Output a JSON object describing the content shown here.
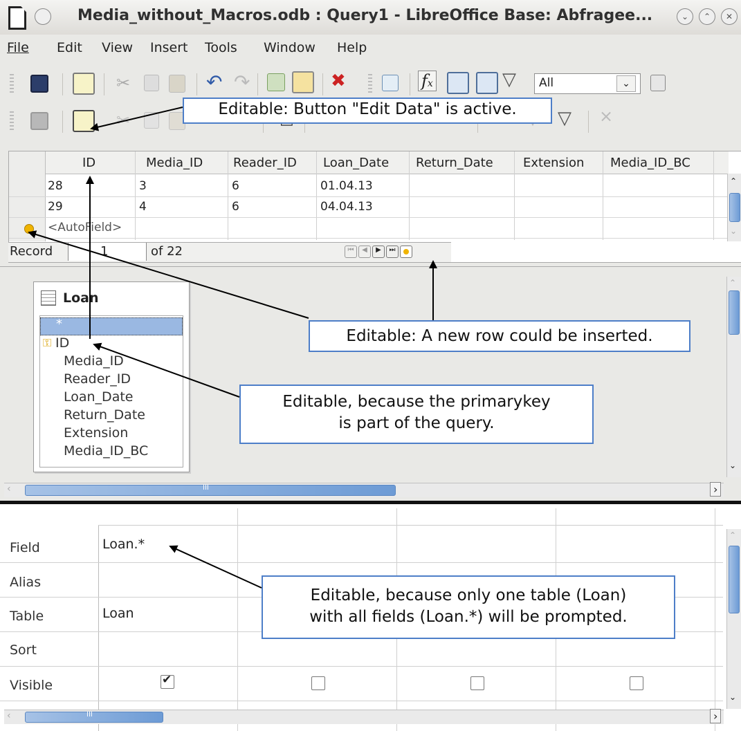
{
  "window": {
    "title": "Media_without_Macros.odb : Query1 - LibreOffice Base: Abfragee..."
  },
  "menu": [
    {
      "label": "File"
    },
    {
      "label": "Edit"
    },
    {
      "label": "View"
    },
    {
      "label": "Insert"
    },
    {
      "label": "Tools"
    },
    {
      "label": "Window"
    },
    {
      "label": "Help"
    }
  ],
  "toolbar": {
    "limit_value": "All"
  },
  "grid": {
    "columns": [
      "ID",
      "Media_ID",
      "Reader_ID",
      "Loan_Date",
      "Return_Date",
      "Extension",
      "Media_ID_BC"
    ],
    "rows": [
      [
        "28",
        "3",
        "6",
        "01.04.13",
        "",
        "",
        ""
      ],
      [
        "29",
        "4",
        "6",
        "04.04.13",
        "",
        "",
        ""
      ]
    ],
    "new_row_placeholder": "<AutoField>",
    "record_label": "Record",
    "record_number": "1",
    "record_of": "of 22"
  },
  "table_window": {
    "name": "Loan",
    "all_fields": "*",
    "fields": [
      "ID",
      "Media_ID",
      "Reader_ID",
      "Loan_Date",
      "Return_Date",
      "Extension",
      "Media_ID_BC"
    ]
  },
  "criteria": {
    "row_labels": [
      "Field",
      "Alias",
      "Table",
      "Sort",
      "Visible"
    ],
    "field_value": "Loan.*",
    "table_value": "Loan",
    "visible": [
      true,
      false,
      false,
      false
    ]
  },
  "scroll": {
    "glyph": "III"
  },
  "callouts": {
    "edit_data": "Editable: Button \"Edit Data\" is active.",
    "new_row": "Editable: A new row could be inserted.",
    "primary_key_line1": "Editable, because the primarykey",
    "primary_key_line2": "is part of the query.",
    "one_table_line1": "Editable, because only one table (Loan)",
    "one_table_line2": "with all fields (Loan.*) will be prompted."
  },
  "colors": {
    "callout_border": "#4d7ec8",
    "scroll_thumb": "#6d9bd5",
    "autofield_marker": "#f0b400"
  }
}
